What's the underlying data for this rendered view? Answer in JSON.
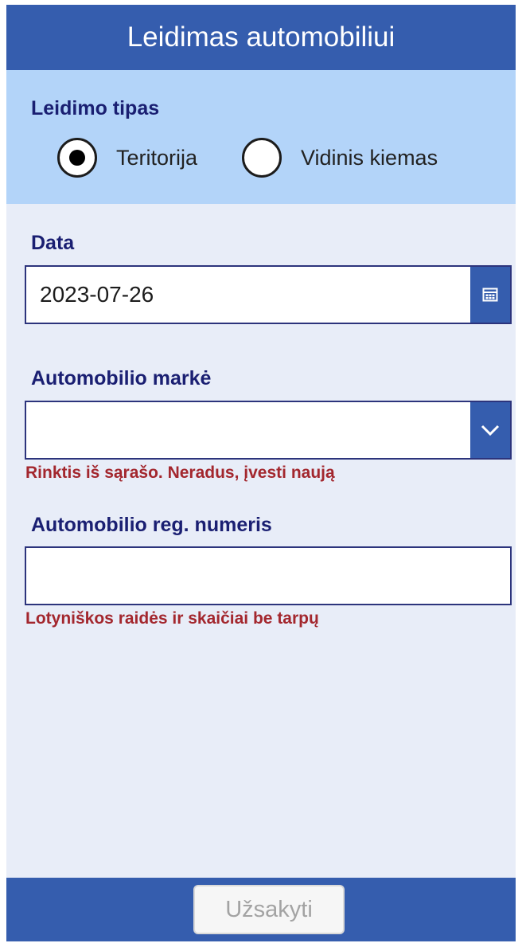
{
  "header": {
    "title": "Leidimas automobiliui"
  },
  "permit_type": {
    "label": "Leidimo tipas",
    "options": [
      {
        "label": "Teritorija",
        "selected": true
      },
      {
        "label": "Vidinis kiemas",
        "selected": false
      }
    ]
  },
  "date_field": {
    "label": "Data",
    "value": "2023-07-26",
    "icon": "calendar-icon"
  },
  "make_field": {
    "label": "Automobilio markė",
    "value": "",
    "icon": "chevron-down-icon",
    "hint": "Rinktis iš sąrašo. Neradus, įvesti naują"
  },
  "reg_field": {
    "label": "Automobilio reg. numeris",
    "value": "",
    "hint": "Lotyniškos raidės ir skaičiai be tarpų"
  },
  "footer": {
    "submit_label": "Užsakyti",
    "submit_enabled": false
  },
  "colors": {
    "accent": "#355dae",
    "label": "#1a1f72",
    "hint": "#a3272e",
    "panel": "#b3d4f9",
    "background": "#e8edf8"
  }
}
